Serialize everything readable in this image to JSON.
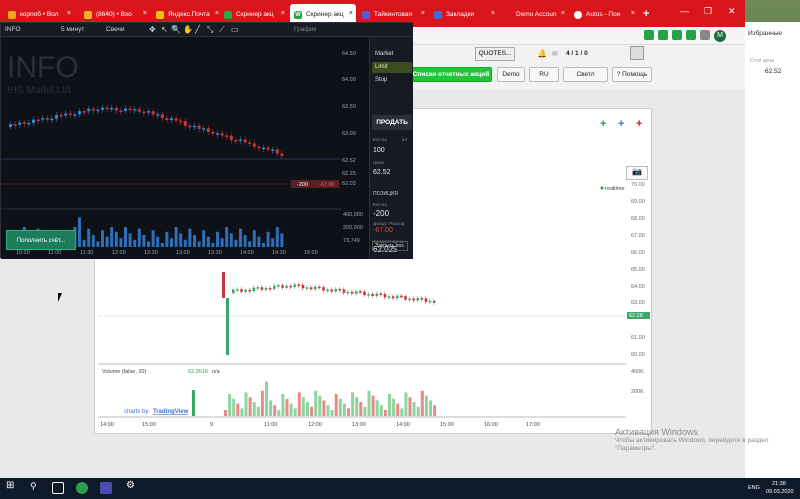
{
  "tabs": [
    {
      "label": "корпоб • Вол",
      "color": "#e8a91a"
    },
    {
      "label": "(8640) • Вхо",
      "color": "#f0b12b"
    },
    {
      "label": "Яндекс.Почта",
      "color": "#e7c215"
    },
    {
      "label": "Скринер акц",
      "color": "#29a847"
    },
    {
      "label": "Скринер акц",
      "color": "#25a244"
    },
    {
      "label": "Тайкинтовая",
      "color": "#5a5ad0"
    },
    {
      "label": "Закладки",
      "color": "#3a6fd8"
    },
    {
      "label": "Demo Accoun",
      "color": "#d9151b"
    },
    {
      "label": "Autos - Пои",
      "color": "#ffffff"
    }
  ],
  "toolbar": {
    "quotes": "QUOTES...",
    "counter": "4 / 1 / 0",
    "reports_button": "Списки отчетных акций",
    "demo_button": "Demo",
    "lang_button": "RU",
    "theme_button": "Светл",
    "help_button": "? Помощь",
    "stop_price_label": "Стоп цена",
    "stop_price": "62.52"
  },
  "dark": {
    "ticker": "INFO",
    "period": "5 минут",
    "candles": "Свечи",
    "graph_label": "График",
    "big_ticker": "INFO",
    "company": "IHS Markit Ltd",
    "price_ticks": [
      "64.50",
      "64.00",
      "63.50",
      "63.00",
      "62.52",
      "62.25",
      "62.03"
    ],
    "vol_ticks": [
      "400,000",
      "200,000",
      "73,749"
    ],
    "time_ticks": [
      "10:00",
      "11:00",
      "11:30",
      "12:00",
      "12:30",
      "13:00",
      "13:30",
      "14:00",
      "14:30",
      "15:00"
    ],
    "position_pnl": "-200",
    "position_pnl2": "-67.00",
    "fill_button": "Поnолнить счёт..."
  },
  "order": {
    "market": "Market",
    "limit": "Limit",
    "stop": "Stop",
    "sell": "ПРОДАТЬ",
    "qty_label": "Кол-во",
    "qty_unit": "шт",
    "qty": "100",
    "price_label": "Цена",
    "price": "62.52",
    "position_label": "ПОЗИЦИЯ",
    "amount_label": "Кол-во",
    "amount": "-200",
    "pnl_label": "Доход / Расход",
    "pnl": "-67.00",
    "avg_label": "Средняя Цена",
    "avg": "62.025",
    "close_button": "Закрыть поз."
  },
  "big_chart": {
    "realtime": "realtime",
    "price_ticks": [
      "70.00",
      "69.00",
      "68.00",
      "67.00",
      "66.00",
      "65.00",
      "64.00",
      "63.00",
      "62.28",
      "61.00",
      "60.00"
    ],
    "current_price": "62.28",
    "volume_label": "Volume (false, 20)",
    "volume_value": "62.051K",
    "volume_na": "n/a",
    "vol_ticks": [
      "400K",
      "200K"
    ],
    "time_ticks": [
      "14:00",
      "15:00",
      "9",
      "11:00",
      "12:00",
      "13:00",
      "14:00",
      "15:00",
      "16:00",
      "17:00"
    ],
    "credit": "charts by",
    "credit_brand": "TradingView"
  },
  "watermark": {
    "title": "Активация Windows",
    "line1": "Чтобы активировать Windows, перейдите в раздел",
    "line2": "\"Параметры\"."
  },
  "taskbar": {
    "lang": "ENG",
    "time": "21:38",
    "date": "09.03.2020"
  },
  "right": {
    "bookmarks": "Избранные"
  }
}
